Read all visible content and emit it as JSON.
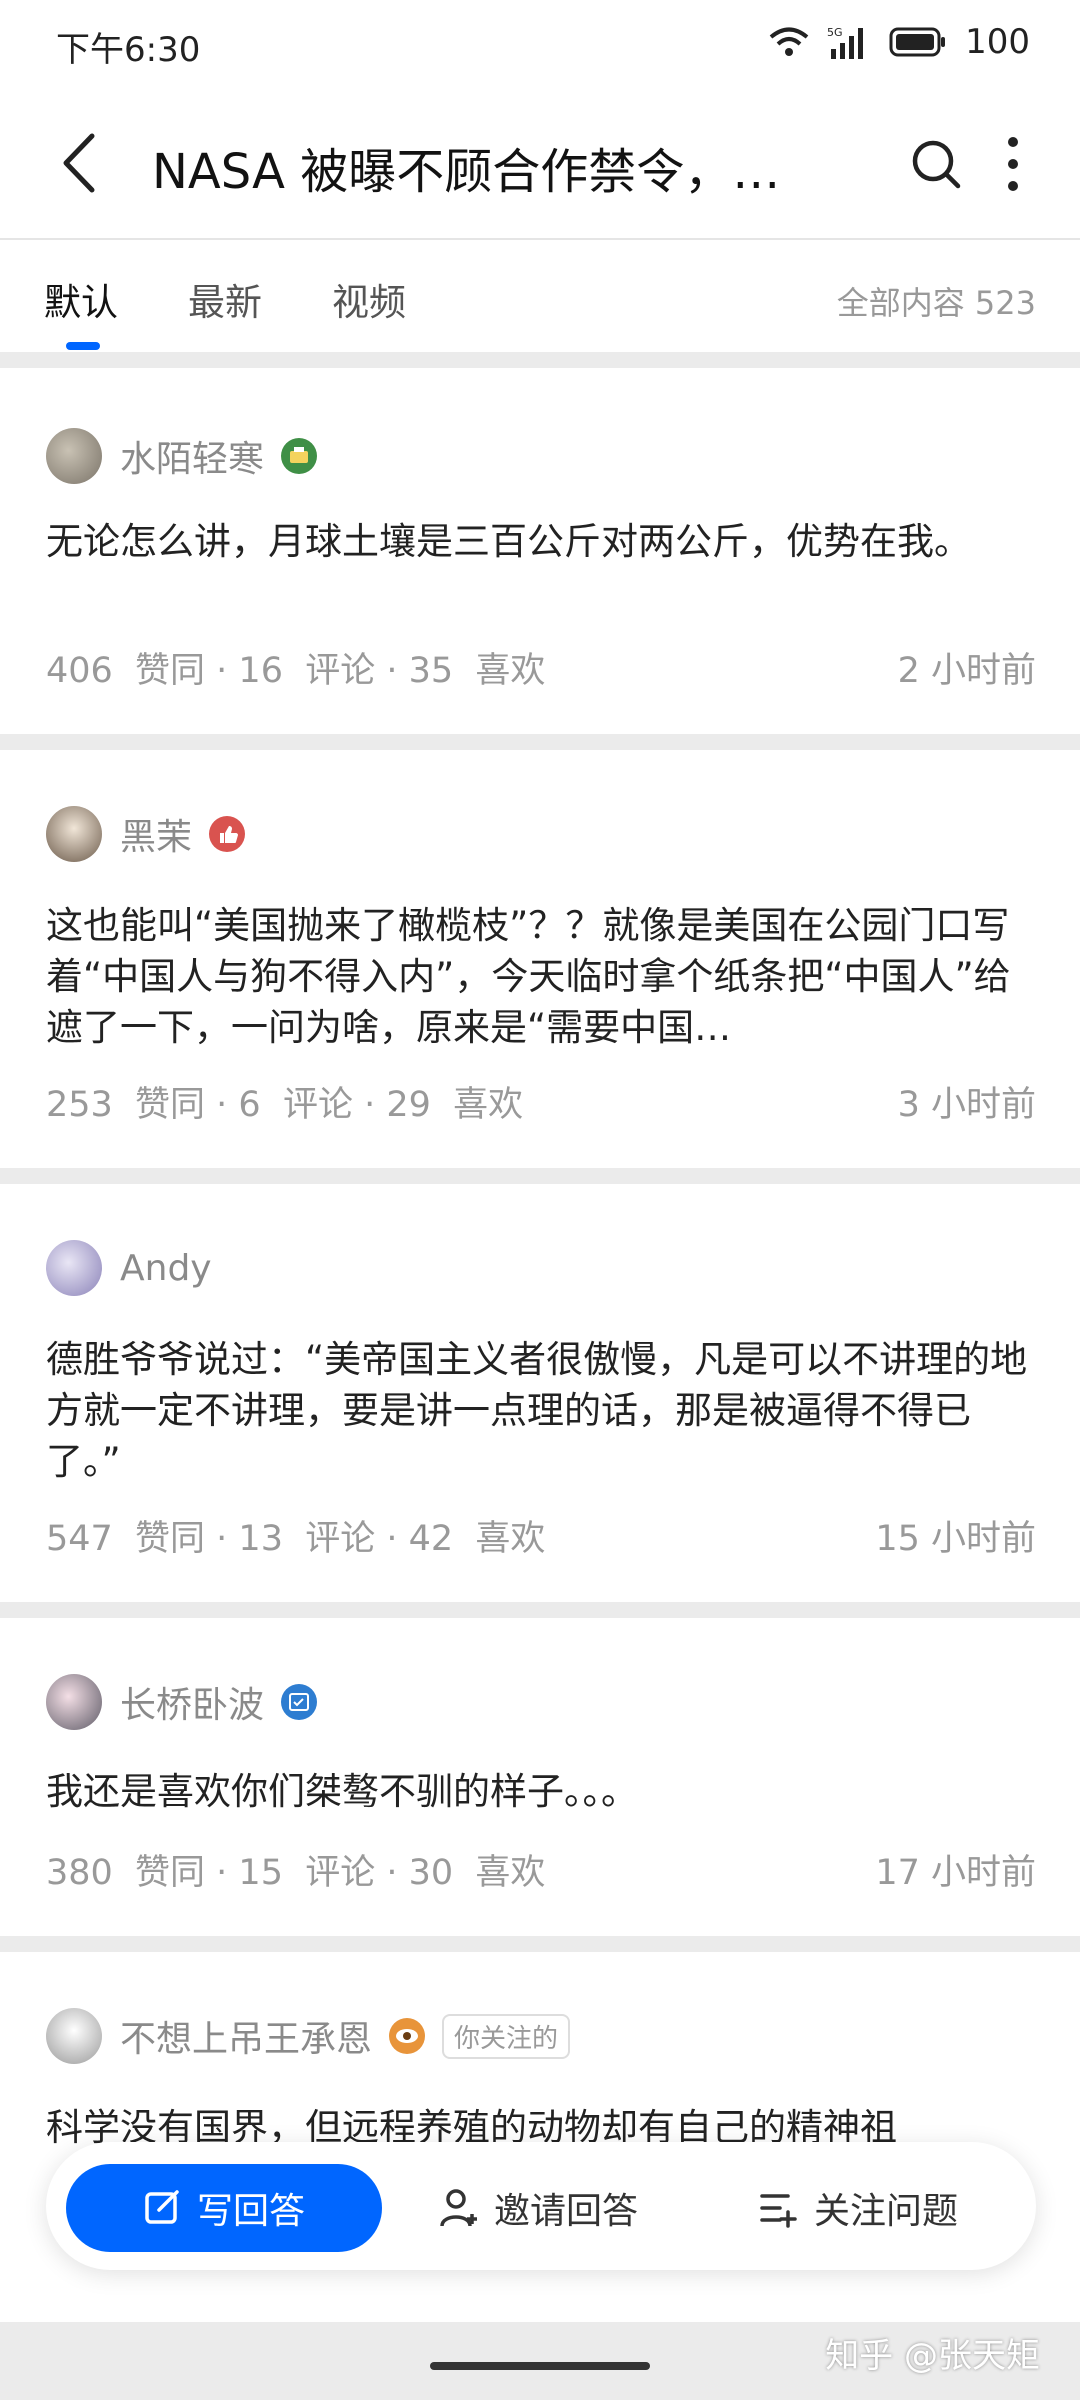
{
  "status": {
    "time": "下午6:30",
    "battery": "100",
    "network": "5G"
  },
  "header": {
    "title": "NASA 被曝不顾合作禁令，…"
  },
  "tabs": [
    {
      "label": "默认"
    },
    {
      "label": "最新"
    },
    {
      "label": "视频"
    }
  ],
  "total_label": "全部内容 523",
  "answers": [
    {
      "author": "水陌轻寒",
      "content": "无论怎么讲，月球土壤是三百公斤对两公斤，优势在我。",
      "meta": "406  赞同 · 16  评论 · 35  喜欢",
      "time": "2 小时前"
    },
    {
      "author": "黑茉",
      "content": "这也能叫“美国抛来了橄榄枝”？？就像是美国在公园门口写着“中国人与狗不得入内”，今天临时拿个纸条把“中国人”给遮了一下，一问为啥，原来是“需要中国…",
      "meta": "253  赞同 · 6  评论 · 29  喜欢",
      "time": "3 小时前"
    },
    {
      "author": "Andy",
      "content": "德胜爷爷说过：“美帝国主义者很傲慢，凡是可以不讲理的地方就一定不讲理，要是讲一点理的话，那是被逼得不得已了。”",
      "meta": "547  赞同 · 13  评论 · 42  喜欢",
      "time": "15 小时前"
    },
    {
      "author": "长桥卧波",
      "content": "我还是喜欢你们桀骜不驯的样子。。。",
      "meta": "380  赞同 · 15  评论 · 30  喜欢",
      "time": "17 小时前"
    },
    {
      "author": "不想上吊王承恩",
      "tag": "你关注的",
      "content": "科学没有国界，但远程养殖的动物却有自己的精神祖"
    }
  ],
  "actions": {
    "write": "写回答",
    "invite": "邀请回答",
    "follow": "关注问题"
  },
  "watermark": "知乎 @张天矩",
  "colors": {
    "accent": "#0066ff",
    "meta": "#999999"
  }
}
